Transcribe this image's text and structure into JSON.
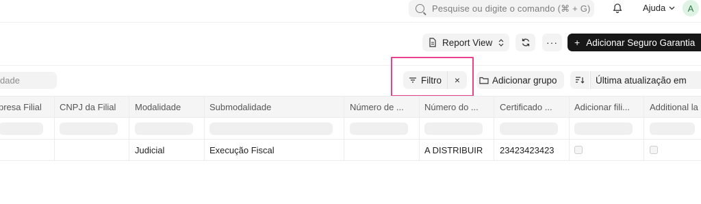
{
  "navbar": {
    "search_placeholder": "Pesquise ou digite o comando (⌘ + G)",
    "help_label": "Ajuda",
    "avatar_initial": "A"
  },
  "header": {
    "view_label": "Report View",
    "more_label": "···",
    "primary_label": "Adicionar Seguro Garantia"
  },
  "filters": {
    "name_filter_placeholder": "dade",
    "filter_label": "Filtro",
    "clear_label": "×",
    "group_label": "Adicionar grupo",
    "sort_label": "Última atualização em"
  },
  "table": {
    "columns": [
      "presa Filial",
      "CNPJ da Filial",
      "Modalidade",
      "Submodalidade",
      "Número de ...",
      "Número do ...",
      "Certificado ...",
      "Adicionar fili...",
      "Additional la"
    ],
    "rows": [
      [
        "",
        "",
        "Judicial",
        "Execução Fiscal",
        "",
        "A DISTRIBUIR",
        "23423423423",
        "",
        ""
      ]
    ]
  },
  "colors": {
    "highlight": "#e8418e",
    "primary_button": "#171717"
  }
}
